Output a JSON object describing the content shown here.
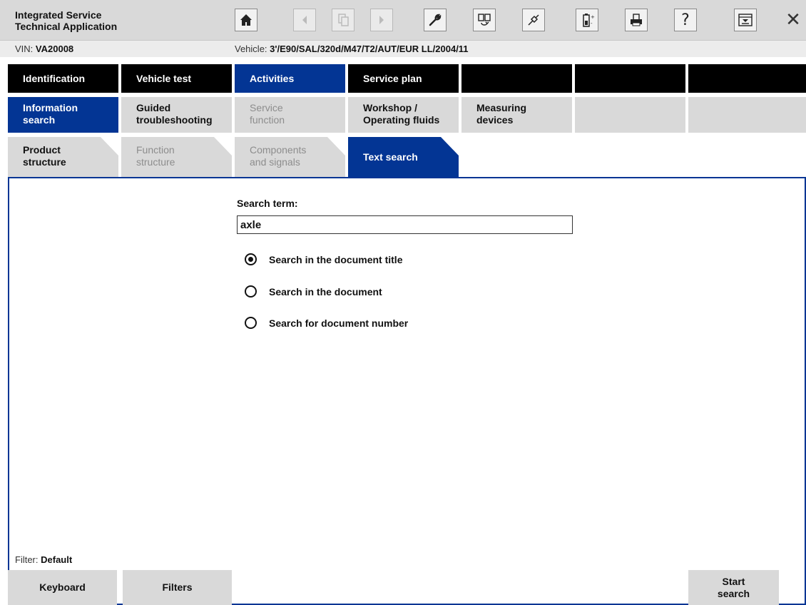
{
  "header": {
    "app_title": "Integrated Service\nTechnical Application",
    "toolbar": [
      {
        "name": "home-icon",
        "enabled": true
      },
      {
        "name": "back-arrow-icon",
        "enabled": false
      },
      {
        "name": "documents-icon",
        "enabled": false
      },
      {
        "name": "forward-arrow-icon",
        "enabled": false
      },
      {
        "name": "wrench-icon",
        "enabled": true
      },
      {
        "name": "display-swap-icon",
        "enabled": true
      },
      {
        "name": "connection-plug-icon",
        "enabled": true
      },
      {
        "name": "battery-icon",
        "enabled": true
      },
      {
        "name": "printer-icon",
        "enabled": true
      },
      {
        "name": "help-icon",
        "enabled": true,
        "glyph": "?"
      },
      {
        "name": "minimize-window-icon",
        "enabled": true
      },
      {
        "name": "close-icon",
        "enabled": true,
        "glyph": "✕"
      }
    ]
  },
  "vehicle_bar": {
    "vin_label": "VIN:",
    "vin_value": "VA20008",
    "vehicle_label": "Vehicle:",
    "vehicle_value": "3'/E90/SAL/320d/M47/T2/AUT/EUR LL/2004/11"
  },
  "main_nav": [
    {
      "label": "Identification",
      "active": false
    },
    {
      "label": "Vehicle test",
      "active": false
    },
    {
      "label": "Activities",
      "active": true
    },
    {
      "label": "Service plan",
      "active": false
    },
    {
      "label": "",
      "active": false
    },
    {
      "label": "",
      "active": false
    },
    {
      "label": "",
      "active": false
    }
  ],
  "sub_nav": [
    {
      "label": "Information\nsearch",
      "state": "active"
    },
    {
      "label": "Guided\ntroubleshooting",
      "state": "normal"
    },
    {
      "label": "Service\nfunction",
      "state": "disabled"
    },
    {
      "label": "Workshop /\nOperating fluids",
      "state": "normal"
    },
    {
      "label": "Measuring\ndevices",
      "state": "normal"
    },
    {
      "label": "",
      "state": "normal"
    },
    {
      "label": "",
      "state": "normal"
    }
  ],
  "tabs": [
    {
      "label": "Product\nstructure",
      "state": "normal"
    },
    {
      "label": "Function\nstructure",
      "state": "disabled"
    },
    {
      "label": "Components\nand signals",
      "state": "disabled"
    },
    {
      "label": "Text search",
      "state": "active"
    }
  ],
  "search": {
    "label": "Search term:",
    "value": "axle",
    "options": [
      {
        "label": "Search in the document title",
        "selected": true
      },
      {
        "label": "Search in the document",
        "selected": false
      },
      {
        "label": "Search for document number",
        "selected": false
      }
    ]
  },
  "filter": {
    "label": "Filter:",
    "value": "Default"
  },
  "bottom_buttons": {
    "keyboard": "Keyboard",
    "filters": "Filters",
    "start_search": "Start\nsearch"
  },
  "colors": {
    "accent": "#033594",
    "nav_bg": "#000000",
    "panel_bg": "#d9d9d9"
  }
}
